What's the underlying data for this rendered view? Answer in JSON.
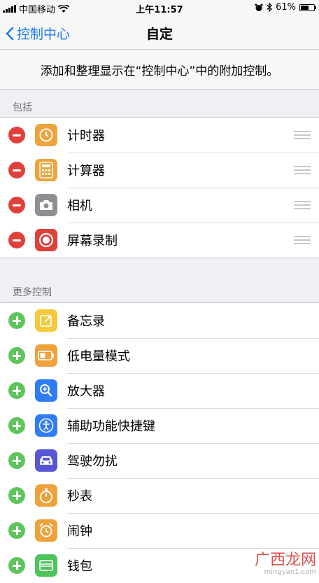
{
  "status_bar": {
    "carrier": "中国移动",
    "time": "上午11:57",
    "battery": "61%",
    "battery_level": 0.61
  },
  "nav": {
    "back_label": "控制中心",
    "title": "自定"
  },
  "description": "添加和整理显示在“控制中心”中的附加控制。",
  "included": {
    "header": "包括",
    "items": [
      {
        "label": "计时器",
        "icon": "timer-icon",
        "color": "#f0a23a"
      },
      {
        "label": "计算器",
        "icon": "calculator-icon",
        "color": "#f0a23a"
      },
      {
        "label": "相机",
        "icon": "camera-icon",
        "color": "#8e8e93"
      },
      {
        "label": "屏幕录制",
        "icon": "screen-record-icon",
        "color": "#e0403a"
      }
    ]
  },
  "more": {
    "header": "更多控制",
    "items": [
      {
        "label": "备忘录",
        "icon": "notes-icon",
        "color": "#f5c93b"
      },
      {
        "label": "低电量模式",
        "icon": "low-power-icon",
        "color": "#f0a23a"
      },
      {
        "label": "放大器",
        "icon": "magnifier-icon",
        "color": "#2f7cf6"
      },
      {
        "label": "辅助功能快捷键",
        "icon": "accessibility-icon",
        "color": "#2f7cf6"
      },
      {
        "label": "驾驶勿扰",
        "icon": "car-icon",
        "color": "#5856d6"
      },
      {
        "label": "秒表",
        "icon": "stopwatch-icon",
        "color": "#f0a23a"
      },
      {
        "label": "闹钟",
        "icon": "alarm-icon",
        "color": "#f0a23a"
      },
      {
        "label": "钱包",
        "icon": "wallet-icon",
        "color": "#4cc35b"
      }
    ]
  },
  "watermark": {
    "text": "广西龙网",
    "sub": "mingyan1.com"
  }
}
